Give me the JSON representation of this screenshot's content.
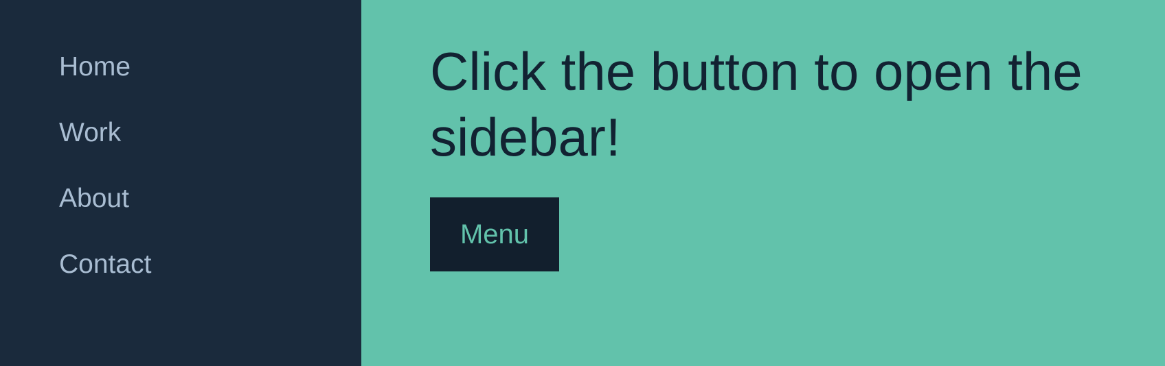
{
  "colors": {
    "sidebar_bg": "#1a2a3c",
    "sidebar_text": "#a9bdd2",
    "main_bg": "#62c2ab",
    "heading_text": "#122232",
    "button_bg": "#121f2d",
    "button_text": "#62c2ab"
  },
  "sidebar": {
    "items": [
      {
        "label": "Home"
      },
      {
        "label": "Work"
      },
      {
        "label": "About"
      },
      {
        "label": "Contact"
      }
    ]
  },
  "main": {
    "heading": "Click the button to open the sidebar!",
    "menu_button_label": "Menu"
  }
}
